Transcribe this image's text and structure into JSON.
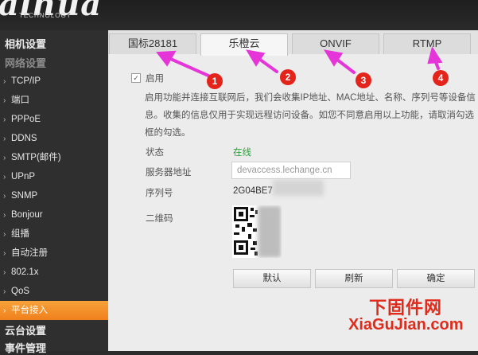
{
  "header": {
    "logo": "alhua",
    "logo_sub": "TECHNOLOGY"
  },
  "sidebar": {
    "section_camera": "相机设置",
    "section_network": "网络设置",
    "items": [
      "TCP/IP",
      "端口",
      "PPPoE",
      "DDNS",
      "SMTP(邮件)",
      "UPnP",
      "SNMP",
      "Bonjour",
      "组播",
      "自动注册",
      "802.1x",
      "QoS",
      "平台接入"
    ],
    "active_item": "平台接入",
    "section_ptz": "云台设置",
    "section_event": "事件管理"
  },
  "tabs": [
    "国标28181",
    "乐橙云",
    "ONVIF",
    "RTMP"
  ],
  "active_tab": "乐橙云",
  "badges": [
    "1",
    "2",
    "3",
    "4"
  ],
  "colors": {
    "annotation_arrow": "#e535d8",
    "badge": "#e4241a",
    "active_nav": "#f0801c",
    "online_status": "#2e9e3b",
    "watermark": "#e02a1c"
  },
  "form": {
    "enable_label": "启用",
    "enable_checked": true,
    "description": "启用功能并连接互联网后，我们会收集IP地址、MAC地址、名称、序列号等设备信息。收集的信息仅用于实现远程访问设备。如您不同意启用以上功能，请取消勾选框的勾选。",
    "status_label": "状态",
    "status_value": "在线",
    "server_label": "服务器地址",
    "server_value": "devaccess.lechange.cn",
    "serial_label": "序列号",
    "serial_value": "2G04BE7",
    "qr_label": "二维码"
  },
  "buttons": {
    "default": "默认",
    "refresh": "刷新",
    "ok": "确定"
  },
  "watermark": {
    "line1": "下固件网",
    "line2": "XiaGuJian.com"
  }
}
